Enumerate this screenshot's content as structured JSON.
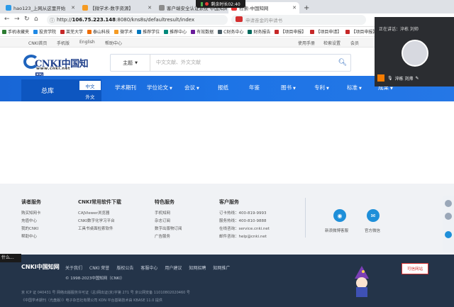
{
  "browser": {
    "tabs": [
      {
        "label": "hao123_上网从这里开始",
        "color": "#2b9ae8"
      },
      {
        "label": "【微学术-数字资源】",
        "color": "#f59b23"
      },
      {
        "label": "客户端安全认证系统·中国知网",
        "color": "#8c8c8c"
      },
      {
        "label": "检索-中国知网",
        "color": "#e83434"
      }
    ],
    "new_tab": "+",
    "url_prefix": "http://",
    "url_host": "106.75.223.148",
    "url_path": ":8080/kns8s/defaultresult/index",
    "search_placeholder": "申请奋金的申请书",
    "timer": "剩余时长02:40"
  },
  "bookmarks": [
    {
      "label": "手机收藏夹",
      "color": "#2e7d32"
    },
    {
      "label": "投资学院",
      "color": "#1e88e5"
    },
    {
      "label": "莱芜大学",
      "color": "#c62828"
    },
    {
      "label": "泰山科技",
      "color": "#ef6c00"
    },
    {
      "label": "微学术",
      "color": "#f59b23"
    },
    {
      "label": "推荐学位",
      "color": "#0277bd"
    },
    {
      "label": "推荐中心",
      "color": "#00897b"
    },
    {
      "label": "有效数据",
      "color": "#6a1b9a"
    },
    {
      "label": "C财务中心",
      "color": "#455a64"
    },
    {
      "label": "财务报告",
      "color": "#00695c"
    },
    {
      "label": "【项目申报】",
      "color": "#c62828"
    },
    {
      "label": "【项目申请】",
      "color": "#c62828"
    },
    {
      "label": "【项目申报】",
      "color": "#c62828"
    },
    {
      "label": "【项目申】",
      "color": "#c62828"
    },
    {
      "label": "暨南IPC",
      "color": "#2e7d32"
    }
  ],
  "cnki_toplinks": {
    "left": [
      "CNKI首页",
      "手机版",
      "English",
      "帮助中心"
    ],
    "right": [
      "使用手册",
      "检索设置",
      "会员"
    ]
  },
  "logo": {
    "title": "CNKI中国知网",
    "url": "www.cnki.net"
  },
  "search": {
    "scope": "主题",
    "placeholder": "中文文献、外文文献"
  },
  "nav": {
    "all": "总库",
    "zh": "中文",
    "en": "外文",
    "items": [
      "学术期刊",
      "学位论文",
      "会议",
      "报纸",
      "年鉴",
      "图书",
      "专利",
      "标准",
      "成果"
    ]
  },
  "chat": {
    "status": "正在讲话：淬栋 刘帅",
    "name": "淬栋 刘帅"
  },
  "footer": {
    "columns": [
      {
        "title": "读者服务",
        "lines": [
          "购买知网卡",
          "充值中心",
          "我的CNKI",
          "帮助中心"
        ]
      },
      {
        "title": "CNKI常用软件下载",
        "lines": [
          "CAJViewer浏览器",
          "CNKI数字化学习平台",
          "工具书桌面检索软件"
        ]
      },
      {
        "title": "特色服务",
        "lines": [
          "手机知网",
          "杂志订阅",
          "数字出版物订阅",
          "广告服务"
        ]
      },
      {
        "title": "客户服务",
        "lines": [
          "订卡热线：400-819-9993",
          "服务热线：400-810-9888",
          "在线咨询：service.cnki.net",
          "邮件咨询：help@cnki.net"
        ]
      }
    ],
    "social": [
      {
        "label": "新浪微博客服",
        "icon": "weibo-icon"
      },
      {
        "label": "官方微信",
        "icon": "wechat-icon"
      }
    ],
    "links": [
      "关于我们",
      "CNKI 荣誉",
      "版权公告",
      "客服中心",
      "用户建议",
      "知网招聘",
      "知网推广"
    ],
    "copyright": "© 1998-2023中国知网（CNKI）",
    "icp": "京 ICP 证 040431 号  网络出版服务许可证（总)网出证(京)字第 271 号  京公网安备 11010802020460 号",
    "pub": "《中国学术期刊（光盘版）》电子杂志社有限公司  KDN 平台基础技术由 KBASE 11.0 提供",
    "badge": "可信网站",
    "corner_text": "什么..."
  }
}
